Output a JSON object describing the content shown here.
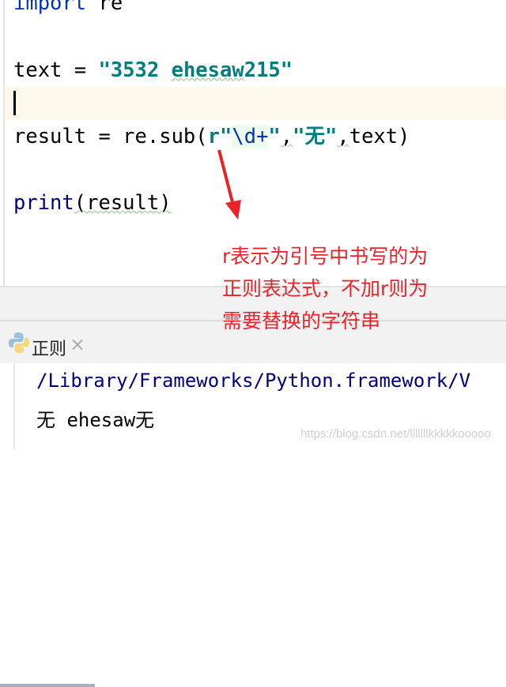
{
  "editor": {
    "lines": {
      "import_kw": "import",
      "import_mod": " re",
      "text_lhs": "text = ",
      "text_str_a": "\"3532 ",
      "text_str_b": "ehesaw",
      "text_str_c": "215\"",
      "result_lhs": "result = re.sub(",
      "result_r": "r\"",
      "result_regex": "\\d+",
      "result_q": "\"",
      "result_comma1": ",",
      "result_str2": "\"无\"",
      "result_comma2": ",",
      "result_tail": "text)",
      "print_fn": "print",
      "print_args": "(result)"
    }
  },
  "annotation": {
    "lines": [
      "r表示为引号中书写的为",
      "正则表达式，不加r则为",
      "需要替换的字符串"
    ],
    "color": "#e8242a"
  },
  "run_panel": {
    "tab_label": "正则",
    "tab_icon": "python-icon",
    "output": [
      "/Library/Frameworks/Python.framework/V",
      "无 ehesaw无"
    ]
  },
  "watermark": "https://blog.csdn.net/lllllllkkkkkooooo"
}
